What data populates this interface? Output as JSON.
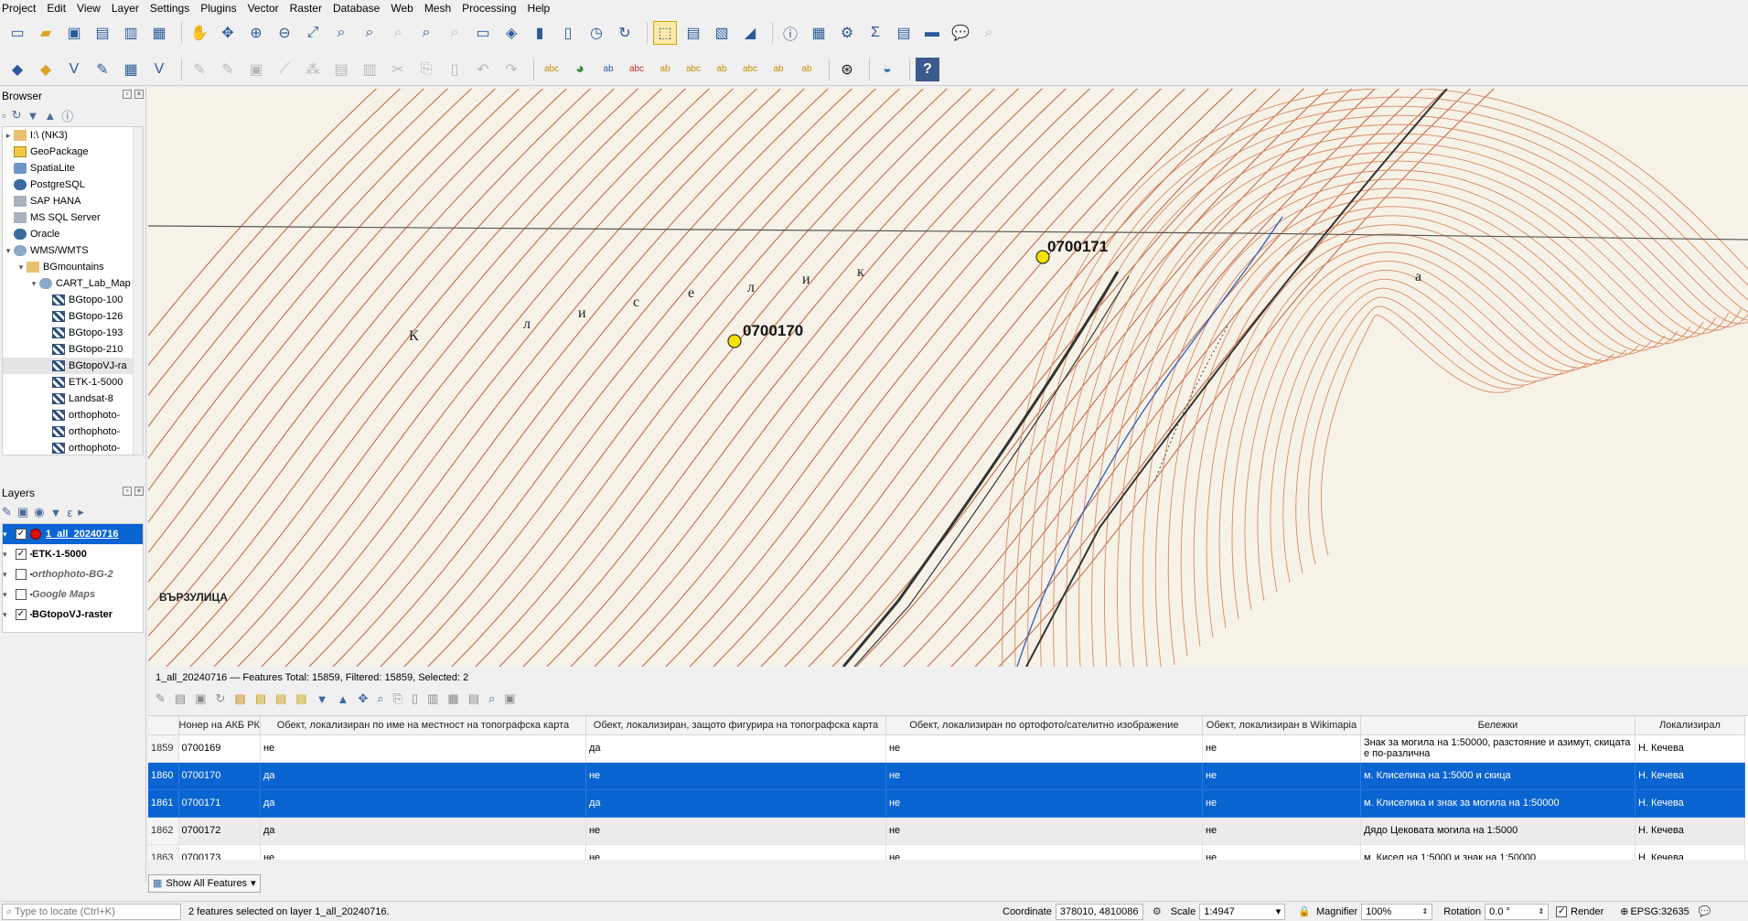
{
  "menu": [
    "Project",
    "Edit",
    "View",
    "Layer",
    "Settings",
    "Plugins",
    "Vector",
    "Raster",
    "Database",
    "Web",
    "Mesh",
    "Processing",
    "Help"
  ],
  "browser": {
    "title": "Browser",
    "items": [
      {
        "label": "I:\\ (NK3)",
        "icon": "folder-icon",
        "indent": 0,
        "arrow": "▸"
      },
      {
        "label": "GeoPackage",
        "icon": "geopackage-icon",
        "indent": 0,
        "arrow": ""
      },
      {
        "label": "SpatiaLite",
        "icon": "spatialite-icon",
        "indent": 0,
        "arrow": ""
      },
      {
        "label": "PostgreSQL",
        "icon": "postgresql-icon",
        "indent": 0,
        "arrow": ""
      },
      {
        "label": "SAP HANA",
        "icon": "sap-hana-icon",
        "indent": 0,
        "arrow": ""
      },
      {
        "label": "MS SQL Server",
        "icon": "mssql-icon",
        "indent": 0,
        "arrow": ""
      },
      {
        "label": "Oracle",
        "icon": "oracle-icon",
        "indent": 0,
        "arrow": ""
      },
      {
        "label": "WMS/WMTS",
        "icon": "wms-icon",
        "indent": 0,
        "arrow": "▾"
      },
      {
        "label": "BGmountains",
        "icon": "connection-icon",
        "indent": 1,
        "arrow": "▾"
      },
      {
        "label": "CART_Lab_Map",
        "icon": "wms-layer-icon",
        "indent": 2,
        "arrow": "▾"
      },
      {
        "label": "BGtopo-100",
        "icon": "raster-icon",
        "indent": 3,
        "arrow": ""
      },
      {
        "label": "BGtopo-126",
        "icon": "raster-icon",
        "indent": 3,
        "arrow": ""
      },
      {
        "label": "BGtopo-193",
        "icon": "raster-icon",
        "indent": 3,
        "arrow": ""
      },
      {
        "label": "BGtopo-210",
        "icon": "raster-icon",
        "indent": 3,
        "arrow": ""
      },
      {
        "label": "BGtopoVJ-ra",
        "icon": "raster-icon",
        "indent": 3,
        "arrow": ""
      },
      {
        "label": "ETK-1-5000",
        "icon": "raster-icon",
        "indent": 3,
        "arrow": ""
      },
      {
        "label": "Landsat-8",
        "icon": "raster-icon",
        "indent": 3,
        "arrow": ""
      },
      {
        "label": "orthophoto-",
        "icon": "raster-icon",
        "indent": 3,
        "arrow": ""
      },
      {
        "label": "orthophoto-",
        "icon": "raster-icon",
        "indent": 3,
        "arrow": ""
      },
      {
        "label": "orthophoto-",
        "icon": "raster-icon",
        "indent": 3,
        "arrow": ""
      }
    ]
  },
  "layers": {
    "title": "Layers",
    "items": [
      {
        "label": "1_all_20240716",
        "checked": true,
        "selected": true,
        "italic": false
      },
      {
        "label": "ETK-1-5000",
        "checked": true,
        "selected": false,
        "italic": false
      },
      {
        "label": "orthophoto-BG-2",
        "checked": false,
        "selected": false,
        "italic": true
      },
      {
        "label": "Google Maps",
        "checked": false,
        "selected": false,
        "italic": true
      },
      {
        "label": "BGtopoVJ-raster",
        "checked": true,
        "selected": false,
        "italic": false
      }
    ]
  },
  "map": {
    "labels": [
      {
        "text": "0700170"
      },
      {
        "text": "0700171"
      }
    ],
    "place_name": "ВЪРЗУЛИЦА",
    "letters": [
      "К",
      "л",
      "и",
      "с",
      "е",
      "л",
      "и",
      "к",
      "а"
    ]
  },
  "attribute_table": {
    "title": "1_all_20240716 — Features Total: 15859, Filtered: 15859, Selected: 2",
    "columns": [
      "",
      "Нонер на АКБ РК",
      "Обект, локализиран по име на местност на топографска карта",
      "Обект, локализиран, защото фигурира на топографска карта",
      "Обект, локализиран по ортофото/сателитно изображение",
      "Обект, локализиран в Wikimapia",
      "Бележки",
      "Локализирал"
    ],
    "rows": [
      {
        "n": "1859",
        "id": "0700169",
        "c1": "не",
        "c2": "да",
        "c3": "не",
        "c4": "не",
        "notes": "Знак за могила на 1:50000, разстояние и азимут, скицата е по-различна",
        "who": "Н. Кечева",
        "selected": false
      },
      {
        "n": "1860",
        "id": "0700170",
        "c1": "да",
        "c2": "не",
        "c3": "не",
        "c4": "не",
        "notes": "м. Клиселика на 1:5000 и скица",
        "who": "Н. Кечева",
        "selected": true
      },
      {
        "n": "1861",
        "id": "0700171",
        "c1": "да",
        "c2": "да",
        "c3": "не",
        "c4": "не",
        "notes": "м. Клиселика и знак за могила на 1:50000",
        "who": "Н. Кечева",
        "selected": true
      },
      {
        "n": "1862",
        "id": "0700172",
        "c1": "да",
        "c2": "не",
        "c3": "не",
        "c4": "не",
        "notes": "Дядо Цековата могила на 1:5000",
        "who": "Н. Кечева",
        "selected": false
      },
      {
        "n": "1863",
        "id": "0700173",
        "c1": "не",
        "c2": "не",
        "c3": "не",
        "c4": "не",
        "notes": "м. Кисел на 1:5000 и знак на 1:50000",
        "who": "Н. Кечева",
        "selected": false
      }
    ],
    "show_all": "Show All Features"
  },
  "status": {
    "locate_placeholder": "Type to locate (Ctrl+K)",
    "message": "2 features selected on layer 1_all_20240716.",
    "coordinate_label": "Coordinate",
    "coordinate": "378010, 4810086",
    "scale_label": "Scale",
    "scale": "1:4947",
    "magnifier_label": "Magnifier",
    "magnifier": "100%",
    "rotation_label": "Rotation",
    "rotation": "0.0 °",
    "render_label": "Render",
    "crs": "EPSG:32635"
  }
}
